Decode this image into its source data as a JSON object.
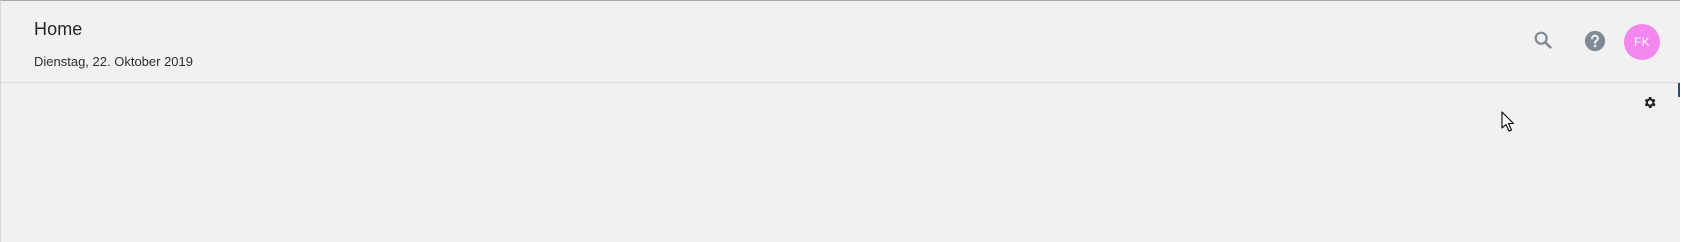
{
  "header": {
    "title": "Home",
    "date": "Dienstag, 22. Oktober 2019"
  },
  "actions": {
    "search_icon": "search-icon",
    "help_icon": "help-icon",
    "settings_icon": "gear-icon"
  },
  "user": {
    "initials": "FK",
    "avatar_color": "#f487ee"
  },
  "colors": {
    "background": "#f1f1f1",
    "icon_gray": "#7e8a95",
    "text_dark": "#22262b"
  }
}
